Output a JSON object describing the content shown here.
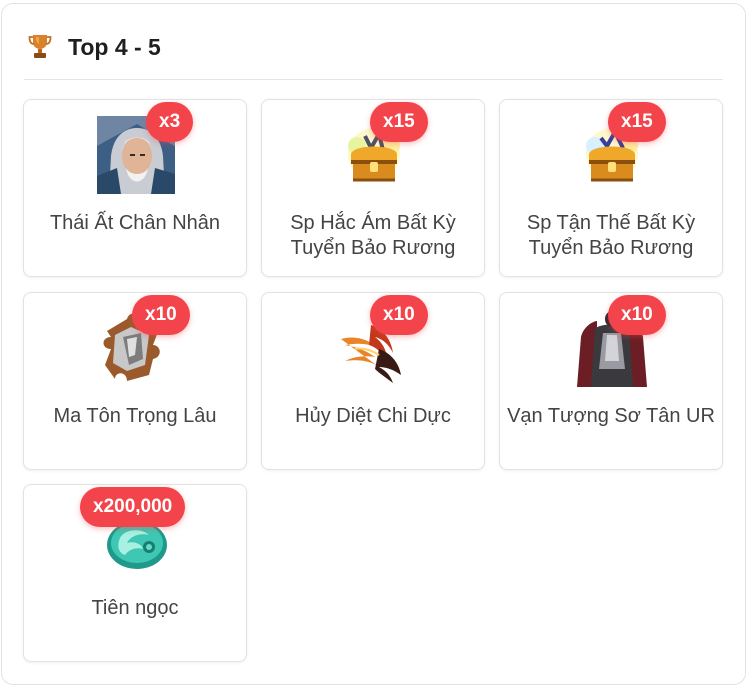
{
  "header": {
    "title": "Top 4 - 5",
    "icon": "trophy-icon"
  },
  "badge_color": "#f4444b",
  "items": [
    {
      "name": "Thái Ất Chân Nhân",
      "qty": "x3",
      "icon": "hero-portrait-icon"
    },
    {
      "name": "Sp Hắc Ám Bất Kỳ Tuyển Bảo Rương",
      "qty": "x15",
      "icon": "treasure-chest-icon"
    },
    {
      "name": "Sp Tận Thế Bất Kỳ Tuyển Bảo Rương",
      "qty": "x15",
      "icon": "treasure-chest-icon"
    },
    {
      "name": "Ma Tôn Trọng Lâu",
      "qty": "x10",
      "icon": "puzzle-piece-icon"
    },
    {
      "name": "Hủy Diệt Chi Dực",
      "qty": "x10",
      "icon": "fire-wings-icon"
    },
    {
      "name": "Vạn Tượng Sơ Tân UR",
      "qty": "x10",
      "icon": "costume-icon"
    },
    {
      "name": "Tiên ngọc",
      "qty": "x200,000",
      "icon": "jade-icon"
    }
  ]
}
